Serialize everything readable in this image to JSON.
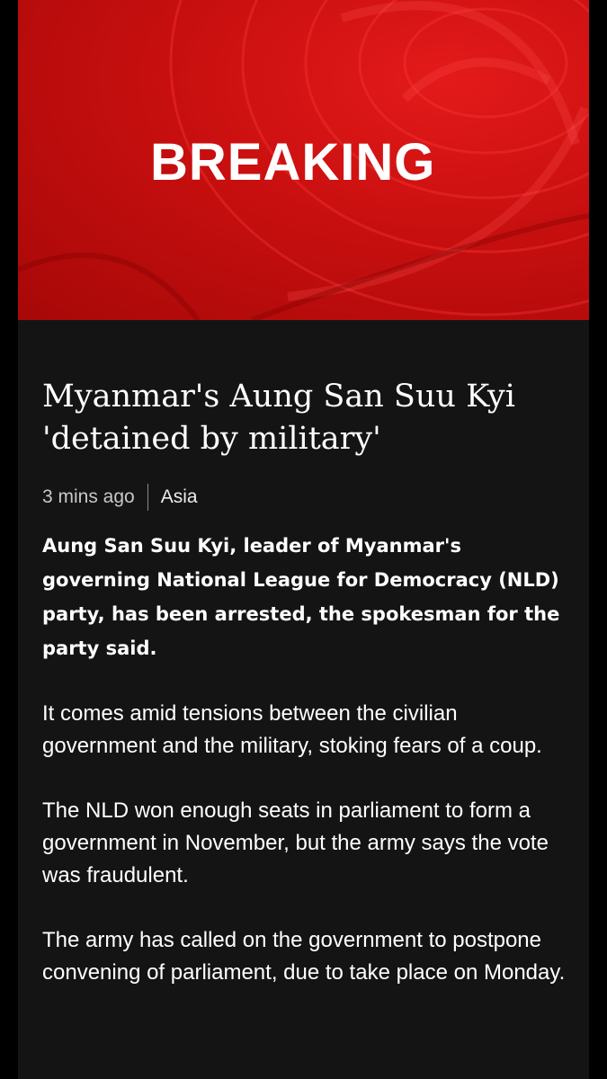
{
  "banner": {
    "label": "BREAKING"
  },
  "article": {
    "headline": "Myanmar's Aung San Suu Kyi 'detained by military'",
    "timestamp": "3 mins ago",
    "section": "Asia",
    "summary": "Aung San Suu Kyi, leader of Myanmar's governing National League for Democracy (NLD) party, has been arrested, the spokesman for the party said.",
    "paragraphs": [
      "It comes amid tensions between the civilian government and the military, stoking fears of a coup.",
      "The NLD won enough seats in parliament to form a government in November, but the army says the vote was fraudulent.",
      "The army has called on the government to postpone convening of parliament, due to take place on Monday."
    ]
  },
  "colors": {
    "banner_red": "#c80f0f",
    "background": "#141414",
    "text": "#ffffff",
    "meta_text": "#c8c8c8"
  }
}
